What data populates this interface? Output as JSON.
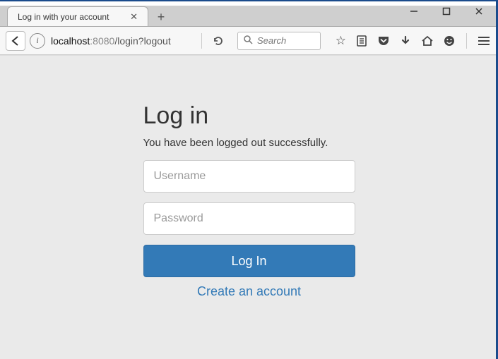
{
  "browser": {
    "tab_title": "Log in with your account",
    "url": {
      "host": "localhost",
      "port": ":8080",
      "path": "/login?logout"
    },
    "search_placeholder": "Search"
  },
  "page": {
    "title": "Log in",
    "message": "You have been logged out successfully.",
    "username_placeholder": "Username",
    "password_placeholder": "Password",
    "submit_label": "Log In",
    "create_link": "Create an account"
  }
}
